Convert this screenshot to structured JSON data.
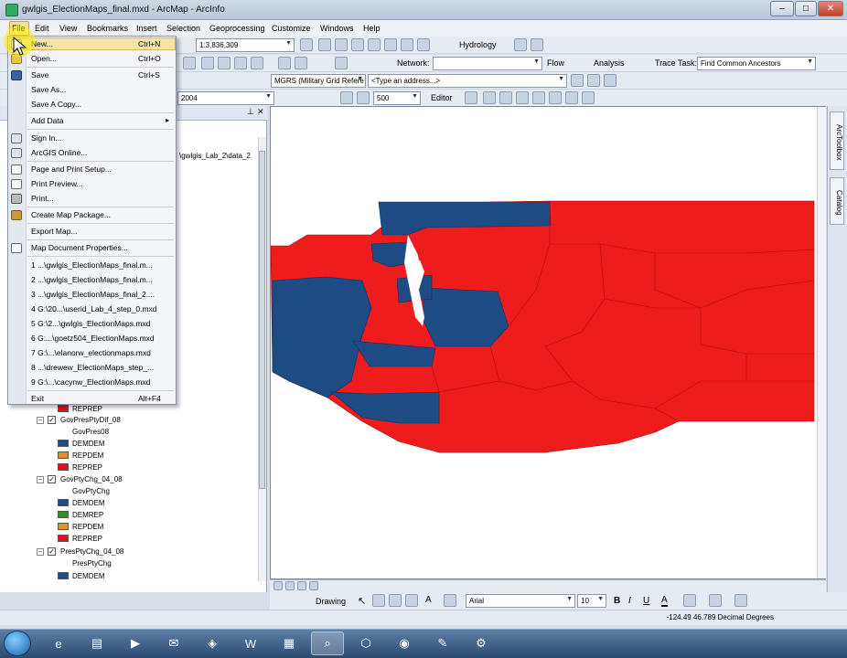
{
  "window": {
    "title": "gwlgis_ElectionMaps_final.mxd - ArcMap - ArcInfo",
    "minimize": "–",
    "maximize": "□",
    "close": "✕"
  },
  "menubar": [
    "File",
    "Edit",
    "View",
    "Bookmarks",
    "Insert",
    "Selection",
    "Geoprocessing",
    "Customize",
    "Windows",
    "Help"
  ],
  "toolbar1": {
    "scale": "1:3,836,309",
    "hydrology": "Hydrology"
  },
  "toolbar2": {
    "network_label": "Network:",
    "network_value": "",
    "flow": "Flow",
    "analysis": "Analysis",
    "trace_task_label": "Trace Task:",
    "trace_task_value": "Find Common Ancestors"
  },
  "toolbar3": {
    "grid_combo": "MGRS (Military Grid Refere",
    "address_combo": "<Type an address...>"
  },
  "toolbar4": {
    "layer_combo": "2004",
    "size_value": "500",
    "editor": "Editor"
  },
  "toc": {
    "path_text": "\\gwlgis_Lab_2\\data_2",
    "items": [
      {
        "type": "swatch",
        "label": "REPREP",
        "color": "#e1121b"
      },
      {
        "type": "layer",
        "label": "GovPresPtyDif_08",
        "checked": true
      },
      {
        "type": "field",
        "label": "GovPres08"
      },
      {
        "type": "swatch",
        "label": "DEMDEM",
        "color": "#1f4c85"
      },
      {
        "type": "swatch",
        "label": "REPDEM",
        "color": "#e0902a"
      },
      {
        "type": "swatch",
        "label": "REPREP",
        "color": "#e1121b"
      },
      {
        "type": "layer",
        "label": "GovPtyChg_04_08",
        "checked": true
      },
      {
        "type": "field",
        "label": "GovPtyChg"
      },
      {
        "type": "swatch",
        "label": "DEMDEM",
        "color": "#1f4c85"
      },
      {
        "type": "swatch",
        "label": "DEMREP",
        "color": "#3a8a2e"
      },
      {
        "type": "swatch",
        "label": "REPDEM",
        "color": "#e0902a"
      },
      {
        "type": "swatch",
        "label": "REPREP",
        "color": "#e1121b"
      },
      {
        "type": "layer",
        "label": "PresPtyChg_04_08",
        "checked": true
      },
      {
        "type": "field",
        "label": "PresPtyChg"
      },
      {
        "type": "swatch",
        "label": "DEMDEM",
        "color": "#1f4c85"
      }
    ]
  },
  "file_menu": {
    "items": [
      {
        "label": "New...",
        "shortcut": "Ctrl+N",
        "icon": "new-document-icon"
      },
      {
        "label": "Open...",
        "shortcut": "Ctrl+O",
        "icon": "open-folder-icon"
      },
      {
        "label": "Save",
        "shortcut": "Ctrl+S",
        "icon": "save-icon"
      },
      {
        "label": "Save As...",
        "shortcut": ""
      },
      {
        "label": "Save A Copy...",
        "shortcut": ""
      },
      {
        "label": "Add Data",
        "shortcut": "▸"
      },
      {
        "label": "Sign In...",
        "shortcut": "",
        "icon": "grid-icon"
      },
      {
        "label": "ArcGIS Online...",
        "shortcut": "",
        "icon": "grid-icon"
      },
      {
        "label": "Page and Print Setup...",
        "shortcut": "",
        "icon": "page-setup-icon"
      },
      {
        "label": "Print Preview...",
        "shortcut": "",
        "icon": "print-preview-icon"
      },
      {
        "label": "Print...",
        "shortcut": "",
        "icon": "printer-icon"
      },
      {
        "label": "Create Map Package...",
        "shortcut": "",
        "icon": "package-icon"
      },
      {
        "label": "Export Map...",
        "shortcut": ""
      },
      {
        "label": "Map Document Properties...",
        "shortcut": "",
        "icon": "properties-icon"
      },
      {
        "label": "1 ...\\gwlgis_ElectionMaps_final.m...",
        "shortcut": ""
      },
      {
        "label": "2 ...\\gwlgis_ElectionMaps_final.m...",
        "shortcut": ""
      },
      {
        "label": "3 ...\\gwlgis_ElectionMaps_final_2....",
        "shortcut": ""
      },
      {
        "label": "4 G:\\20...\\userid_Lab_4_step_0.mxd",
        "shortcut": ""
      },
      {
        "label": "5 G:\\2...\\gwlgis_ElectionMaps.mxd",
        "shortcut": ""
      },
      {
        "label": "6 G:...\\goetz504_ElectionMaps.mxd",
        "shortcut": ""
      },
      {
        "label": "7 G:\\...\\elanorw_electionmaps.mxd",
        "shortcut": ""
      },
      {
        "label": "8 ...\\drewew_ElectionMaps_step_...",
        "shortcut": ""
      },
      {
        "label": "9 G:\\...\\cacynw_ElectionMaps.mxd",
        "shortcut": ""
      },
      {
        "label": "Exit",
        "shortcut": "Alt+F4"
      }
    ]
  },
  "map": {
    "rep_color": "#ee1c1c",
    "dem_color": "#1e4b84"
  },
  "rightdock": {
    "toolbox": "ArcToolbox",
    "catalog": "Catalog"
  },
  "drawbar": {
    "drawing": "Drawing",
    "font": "Arial",
    "size": "10",
    "bold": "B",
    "italic": "I",
    "underline": "U"
  },
  "status": {
    "coordinates": "-124.49  46.789 Decimal Degrees"
  }
}
